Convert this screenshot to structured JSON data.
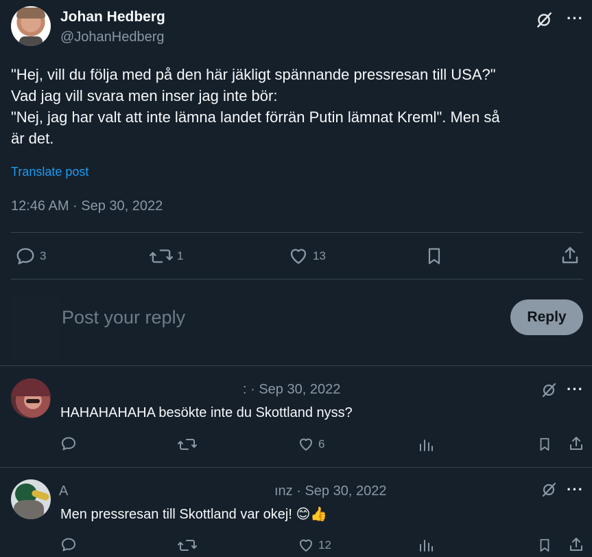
{
  "tweet": {
    "author_name": "Johan Hedberg",
    "author_handle": "@JohanHedberg",
    "text_lines": [
      "\"Hej, vill du följa med på den här jäkligt spännande pressresan till USA?\"",
      "Vad jag vill svara men inser jag inte bör:",
      "\"Nej, jag har valt att inte lämna landet förrän Putin lämnat Kreml\". Men så",
      "är det."
    ],
    "translate_label": "Translate post",
    "timestamp": "12:46 AM · Sep 30, 2022",
    "stats": {
      "replies": "3",
      "reposts": "1",
      "likes": "13"
    }
  },
  "composer": {
    "placeholder": "Post your reply",
    "reply_button": "Reply"
  },
  "replies": [
    {
      "meta": ": · Sep 30, 2022",
      "text": "HAHAHAHAHA besökte inte du Skottland nyss?",
      "replies": "",
      "reposts": "",
      "likes": "6"
    },
    {
      "meta": "ınz · Sep 30, 2022",
      "name_fragment": "A",
      "text": "Men pressresan till Skottland var okej! 😊👍",
      "replies": "",
      "reposts": "",
      "likes": "12"
    }
  ],
  "colors": {
    "background": "#15202b",
    "text_primary": "#f7f9f9",
    "text_secondary": "#8b98a5",
    "link": "#1d9bf0",
    "divider": "#38444d"
  },
  "icons": {
    "grok": "grok-icon",
    "more": "more-icon",
    "reply": "reply-icon",
    "repost": "repost-icon",
    "like": "like-icon",
    "bookmark": "bookmark-icon",
    "share": "share-icon",
    "views": "views-icon"
  }
}
